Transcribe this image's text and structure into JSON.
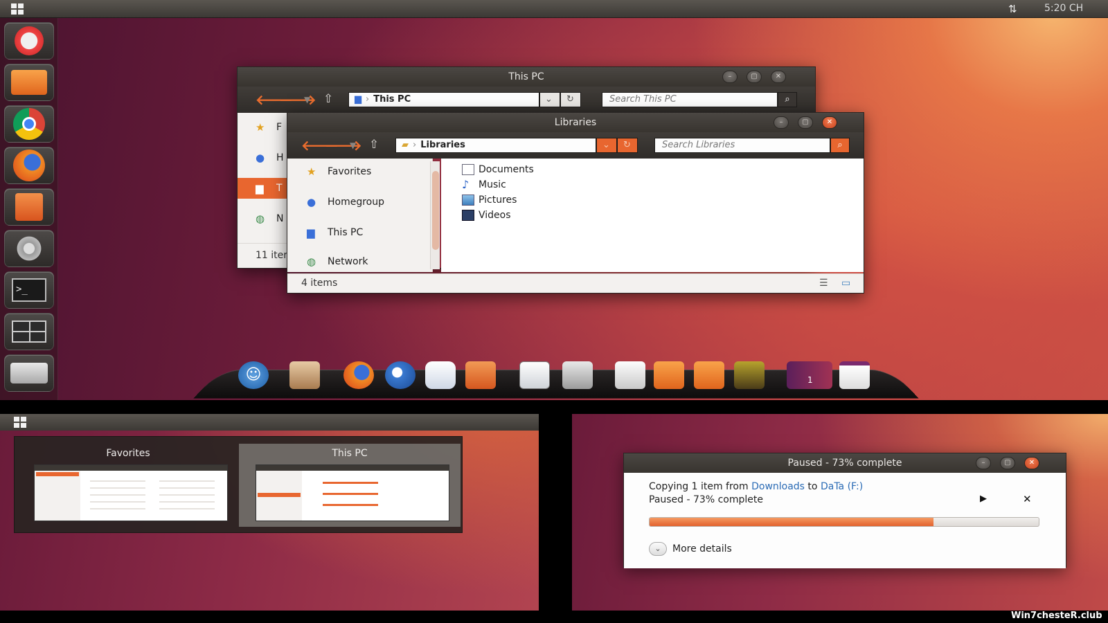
{
  "top_panel": {
    "clock": "5:20 CH",
    "network_icon": "network-arrows-icon"
  },
  "launcher": {
    "items": [
      {
        "name": "dash-home",
        "icon": "ubuntu-logo-icon"
      },
      {
        "name": "files",
        "icon": "folder-icon"
      },
      {
        "name": "chrome",
        "icon": "chrome-icon"
      },
      {
        "name": "firefox",
        "icon": "firefox-icon"
      },
      {
        "name": "software-center",
        "icon": "shopping-bag-icon"
      },
      {
        "name": "system-settings",
        "icon": "settings-tools-icon"
      },
      {
        "name": "terminal",
        "icon": "terminal-icon"
      },
      {
        "name": "workspace-switcher",
        "icon": "workspaces-icon"
      },
      {
        "name": "drive",
        "icon": "hard-drive-icon"
      }
    ]
  },
  "window_thispc": {
    "title": "This PC",
    "address": "This PC",
    "search_placeholder": "Search This PC",
    "sidebar_partial": [
      "F",
      "H",
      "T",
      "N"
    ],
    "status": "11 iter"
  },
  "window_libraries": {
    "title": "Libraries",
    "address": "Libraries",
    "search_placeholder": "Search Libraries",
    "nav": [
      {
        "label": "Favorites",
        "icon": "star-icon"
      },
      {
        "label": "Homegroup",
        "icon": "homegroup-icon"
      },
      {
        "label": "This PC",
        "icon": "computer-icon"
      },
      {
        "label": "Network",
        "icon": "network-icon"
      }
    ],
    "items": [
      {
        "label": "Documents",
        "icon": "documents-icon"
      },
      {
        "label": "Music",
        "icon": "music-icon"
      },
      {
        "label": "Pictures",
        "icon": "pictures-icon"
      },
      {
        "label": "Videos",
        "icon": "videos-icon"
      }
    ],
    "status": "4 items"
  },
  "dock": {
    "items": [
      "accessibility-icon",
      "file-icon",
      "firefox-icon",
      "thunderbird-icon",
      "chat-icon",
      "store-icon",
      "document-viewer-icon",
      "calculator-icon",
      "text-editor-icon",
      "backup-folder-icon",
      "downloads-folder-icon",
      "photos-icon",
      "workspaces-icon",
      "window-icon"
    ],
    "workspace_badge": "1"
  },
  "switcher": {
    "items": [
      {
        "title": "Favorites"
      },
      {
        "title": "This PC"
      }
    ]
  },
  "copy_dialog": {
    "title": "Paused - 73% complete",
    "line1_prefix": "Copying 1 item from ",
    "line1_source": "Downloads",
    "line1_mid": " to ",
    "line1_dest": "DaTa (F:)",
    "line2": "Paused - 73% complete",
    "progress": 0.73,
    "more_details": "More details",
    "resume_icon": "play-icon",
    "cancel_icon": "close-icon"
  },
  "watermark": "Win7chesteR.club",
  "colors": {
    "accent": "#e8662f",
    "link": "#2a6bb5",
    "titlebar": "#403c38"
  }
}
